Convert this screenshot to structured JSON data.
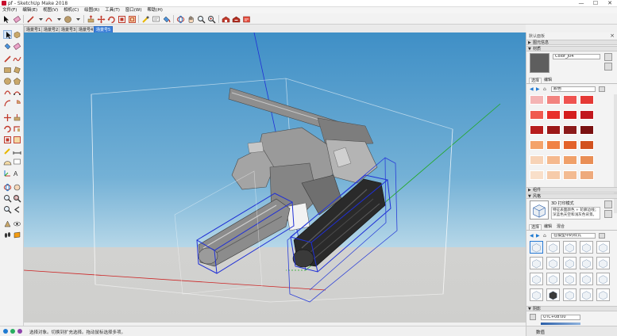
{
  "window": {
    "title": "pf - SketchUp Make 2018",
    "controls": [
      "—",
      "☐",
      "✕"
    ]
  },
  "menu": [
    "文件(F)",
    "编辑(E)",
    "视图(V)",
    "相机(C)",
    "绘图(R)",
    "工具(T)",
    "窗口(W)",
    "帮助(H)"
  ],
  "toolbar": {
    "icons": [
      "select-arrow-icon",
      "eraser-icon",
      "line-pencil-icon",
      "arc-icon",
      "shape-icon",
      "push-pull-icon",
      "move-icon",
      "rotate-icon",
      "scale-icon",
      "offset-icon",
      "tape-measure-icon",
      "text-icon",
      "paint-bucket-icon",
      "orbit-icon",
      "pan-icon",
      "zoom-icon",
      "zoom-extents-icon",
      "warehouse-icon",
      "extension-warehouse-icon",
      "layout-icon"
    ]
  },
  "scene_tabs": [
    {
      "label": "场景号1"
    },
    {
      "label": "场景号2"
    },
    {
      "label": "场景号3"
    },
    {
      "label": "场景号4"
    },
    {
      "label": "场景号5",
      "active": true
    }
  ],
  "status": {
    "text": "选择对象。切换到扩充选择。拖动鼠标选择多项。"
  },
  "tray": {
    "title": "默认面板",
    "entity_info": {
      "header": "图元信息"
    },
    "materials": {
      "header": "材质",
      "material_name": "Color_J04",
      "tabs": [
        "选择",
        "编辑"
      ],
      "category": "颜色",
      "swatches": [
        "#f4b4b4",
        "#f2837f",
        "#ef5350",
        "#e53935",
        "#f05a4f",
        "#e8302b",
        "#d41f1f",
        "#c2181e",
        "#b71c1c",
        "#9b1818",
        "#8b1a1a",
        "#7a1010",
        "#f4a36b",
        "#f08245",
        "#e3622a",
        "#d2521f",
        "#f7d3b7",
        "#f5b98e",
        "#f0a069",
        "#e98e55",
        "#f9dfc9",
        "#f6cbaa",
        "#f3bb92",
        "#eeaa7c"
      ]
    },
    "components": {
      "header": "组件"
    },
    "styles": {
      "header": "风格",
      "style_name": "3D 打印模式",
      "style_desc": "特征表面颜色 + 轮廓边线；深蓝色天空和浅灰色背景。",
      "tabs": [
        "选择",
        "编辑",
        "混合"
      ],
      "collection": "在模型中的样式"
    },
    "shadows": {
      "header": "阴影",
      "utc": "UTC+08:00"
    },
    "value_label": "数值"
  },
  "colors": {
    "accent": "#3c7fd9",
    "bbox_blue": "#1f2fd6",
    "axis_red": "#cc2222",
    "axis_green": "#1fa81f"
  }
}
